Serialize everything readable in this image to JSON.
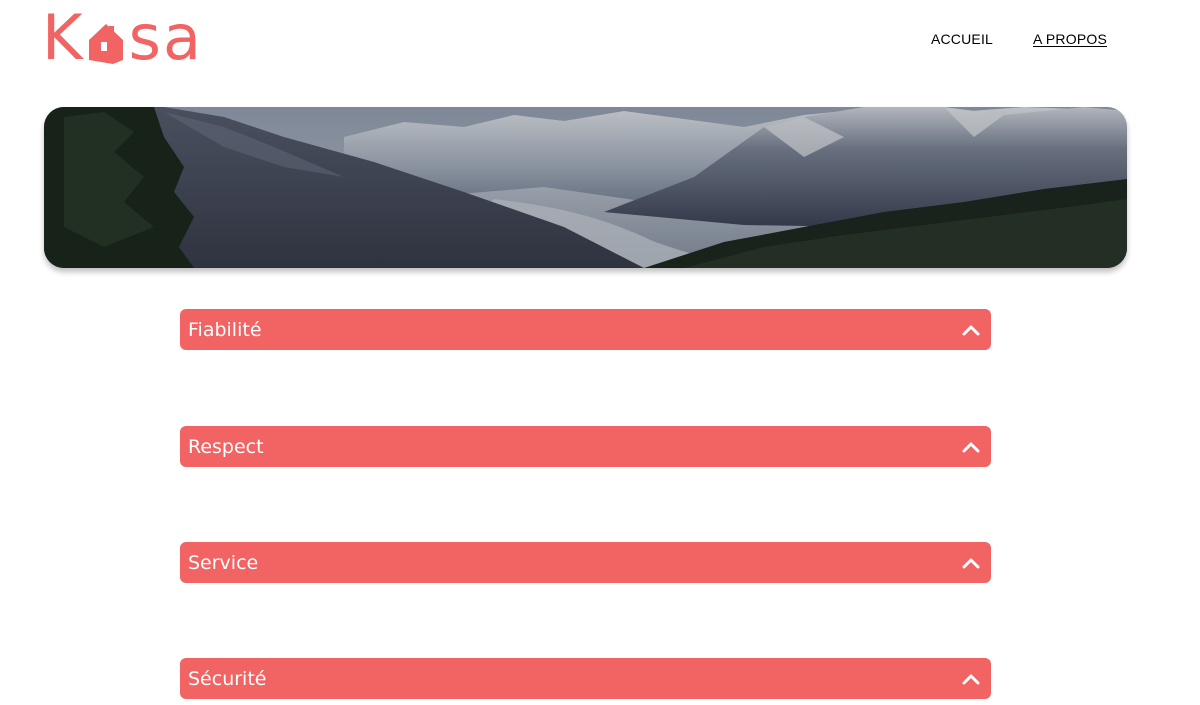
{
  "brand": {
    "logo_letters": [
      "K",
      "s",
      "a"
    ],
    "logo_text": "Kasa",
    "color": "#F16463"
  },
  "nav": {
    "items": [
      {
        "label": "ACCUEIL",
        "active": false
      },
      {
        "label": "A PROPOS",
        "active": true
      }
    ]
  },
  "banner": {
    "image": "mountain-landscape"
  },
  "collapses": [
    {
      "title": "Fiabilité",
      "icon": "chevron-up-icon"
    },
    {
      "title": "Respect",
      "icon": "chevron-up-icon"
    },
    {
      "title": "Service",
      "icon": "chevron-up-icon"
    },
    {
      "title": "Sécurité",
      "icon": "chevron-up-icon"
    }
  ]
}
